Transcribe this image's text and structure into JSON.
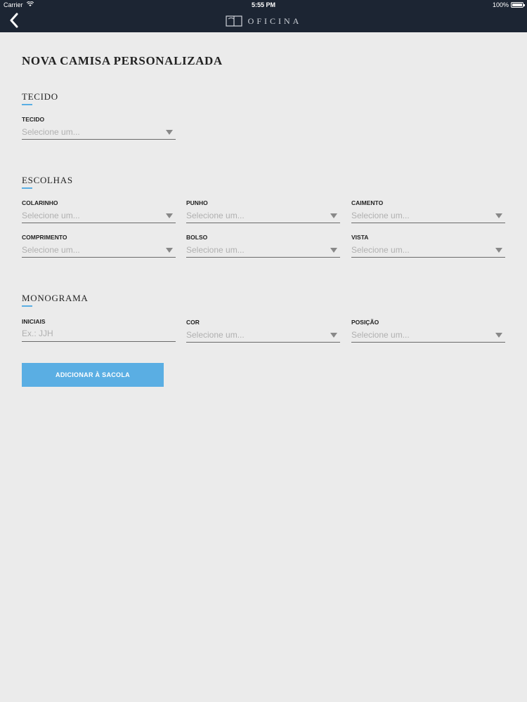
{
  "status_bar": {
    "carrier": "Carrier",
    "time": "5:55 PM",
    "battery": "100%"
  },
  "header": {
    "brand": "OFICINA"
  },
  "page": {
    "title": "NOVA CAMISA PERSONALIZADA"
  },
  "tecido": {
    "title": "TECIDO",
    "fields": [
      {
        "label": "TECIDO",
        "value": "Selecione um..."
      }
    ]
  },
  "escolhas": {
    "title": "ESCOLHAS",
    "fields": [
      {
        "label": "COLARINHO",
        "value": "Selecione um..."
      },
      {
        "label": "PUNHO",
        "value": "Selecione um..."
      },
      {
        "label": "CAIMENTO",
        "value": "Selecione um..."
      },
      {
        "label": "COMPRIMENTO",
        "value": "Selecione um..."
      },
      {
        "label": "BOLSO",
        "value": "Selecione um..."
      },
      {
        "label": "VISTA",
        "value": "Selecione um..."
      }
    ]
  },
  "monograma": {
    "title": "MONOGRAMA",
    "initials": {
      "label": "INICIAIS",
      "placeholder": "Ex.: JJH"
    },
    "fields": [
      {
        "label": "COR",
        "value": "Selecione um..."
      },
      {
        "label": "POSIÇÃO",
        "value": "Selecione um..."
      }
    ]
  },
  "actions": {
    "add_to_bag": "ADICIONAR À SACOLA"
  },
  "colors": {
    "nav_bg": "#1c2533",
    "accent": "#5aaee3",
    "page_bg": "#ebebeb"
  }
}
